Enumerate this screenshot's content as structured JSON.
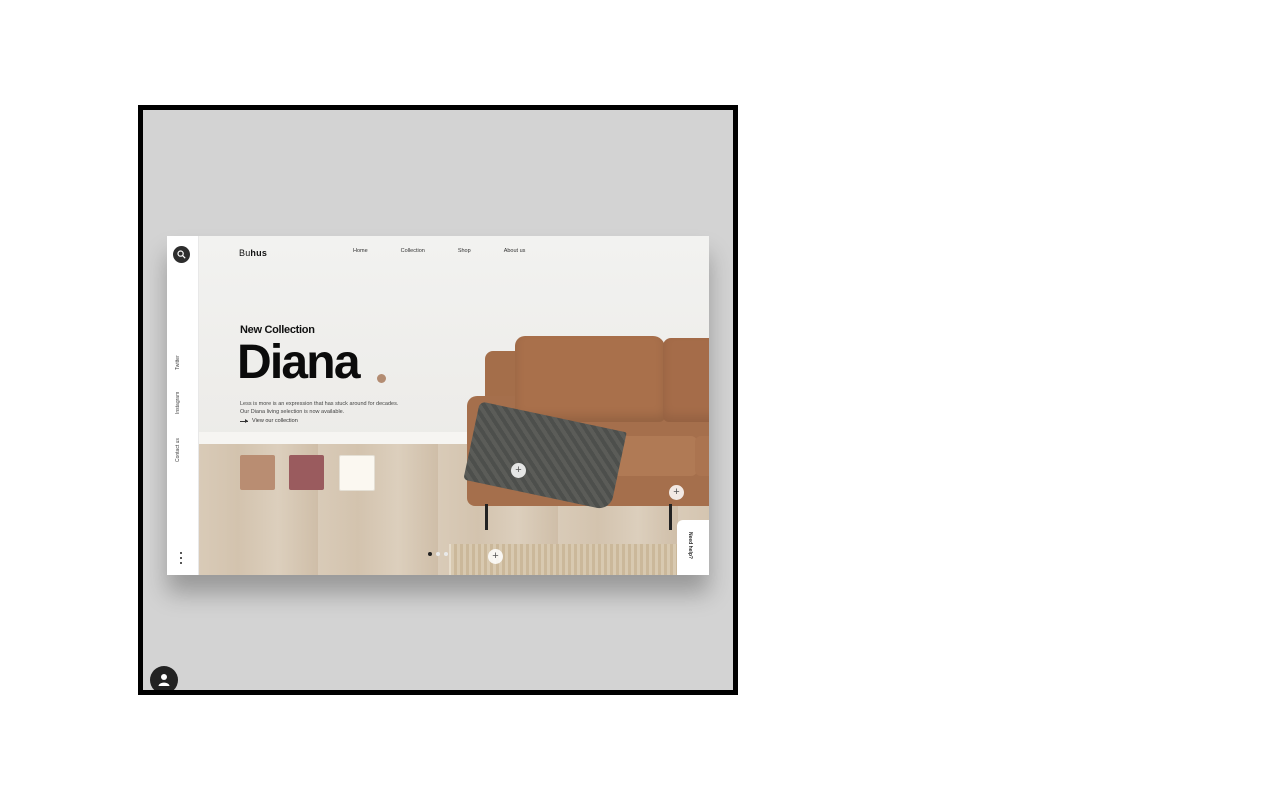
{
  "brand": {
    "logo_prefix": "Bu",
    "logo_suffix": "hus"
  },
  "nav": {
    "items": [
      "Home",
      "Collection",
      "Shop",
      "About us"
    ]
  },
  "side_rail": {
    "links": [
      "Twitter",
      "Instagram",
      "Contact us"
    ],
    "icons": {
      "search": "search-icon",
      "more": "more-dots-icon"
    }
  },
  "hero": {
    "eyebrow": "New Collection",
    "title": "Diana",
    "description_line1": "Less is more is an expression that has stuck around for decades.",
    "description_line2": "Our Diana living selection is now available.",
    "cta": "View our collection"
  },
  "swatches": [
    {
      "name": "tan",
      "color": "#b98d72"
    },
    {
      "name": "rose",
      "color": "#9a5b5e"
    },
    {
      "name": "cream",
      "color": "#fbf8f1"
    }
  ],
  "slider": {
    "total": 3,
    "active": 1
  },
  "help": {
    "label": "Need help?"
  },
  "colors": {
    "accent": "#b38c72",
    "frame_bg": "#d3d3d3",
    "rail_bg": "#ffffff"
  }
}
